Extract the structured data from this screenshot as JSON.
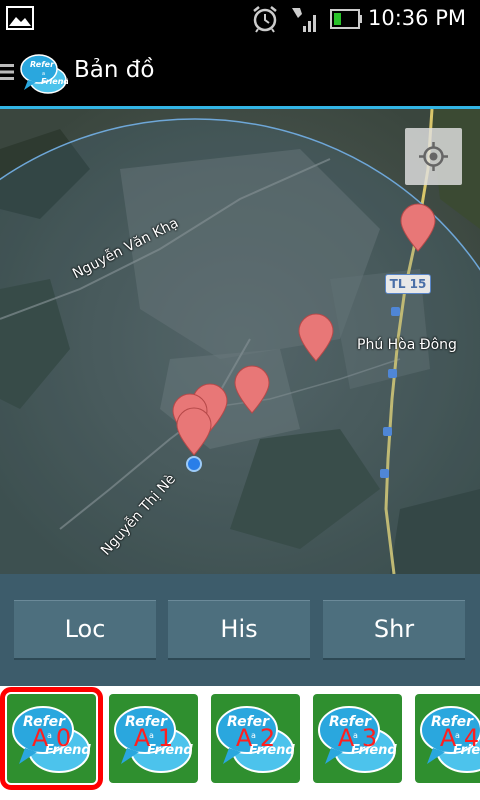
{
  "status_bar": {
    "time": "10:36 PM"
  },
  "action_bar": {
    "title": "Bản đồ",
    "logo_text_1": "Refer",
    "logo_text_2": "a",
    "logo_text_3": "Friend"
  },
  "map": {
    "labels": {
      "road_1": "Nguyễn Văn Khạ",
      "road_2": "Nguyễn Thị Nè",
      "area": "Phú Hòa Đông",
      "shield": "TL 15"
    },
    "marker_count": 6
  },
  "buttons": {
    "loc": "Loc",
    "his": "His",
    "shr": "Shr"
  },
  "tiles": [
    {
      "label": "A 0",
      "selected": true
    },
    {
      "label": "A 1",
      "selected": false
    },
    {
      "label": "A 2",
      "selected": false
    },
    {
      "label": "A 3",
      "selected": false
    },
    {
      "label": "A 4",
      "selected": false
    }
  ],
  "tile_logo": {
    "line1": "Refer",
    "line2": "a",
    "line3": "Friend"
  },
  "colors": {
    "accent": "#33b5e5",
    "button_bar": "#3d5c6b",
    "button": "#4d6f7e",
    "tile_green": "#2f8f2f",
    "selected_outline": "#ff0000",
    "marker": "#e66b6b"
  }
}
